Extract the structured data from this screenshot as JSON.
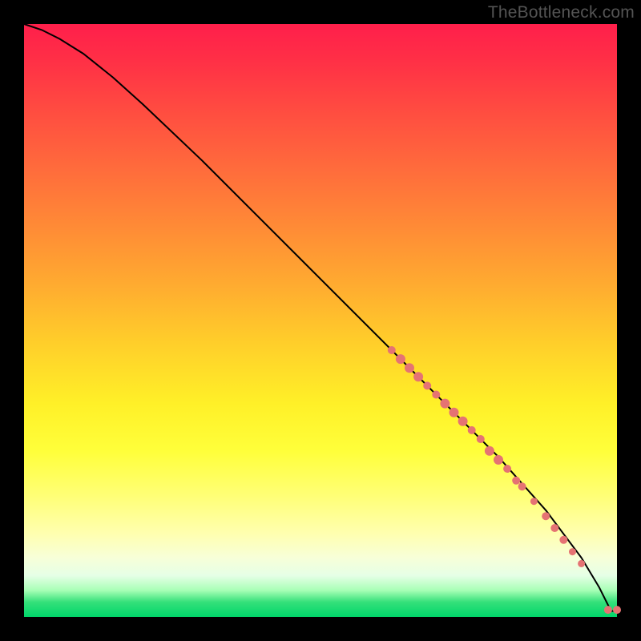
{
  "watermark": "TheBottleneck.com",
  "chart_data": {
    "type": "line",
    "title": "",
    "xlabel": "",
    "ylabel": "",
    "xlim": [
      0,
      100
    ],
    "ylim": [
      0,
      100
    ],
    "grid": false,
    "legend": false,
    "background": "rainbow-vertical-gradient",
    "series": [
      {
        "name": "curve",
        "kind": "line",
        "color": "#000000",
        "x": [
          0,
          3,
          6,
          10,
          15,
          20,
          30,
          40,
          50,
          60,
          70,
          80,
          88,
          94,
          97,
          99,
          100
        ],
        "y": [
          100,
          99,
          97.5,
          95,
          91,
          86.5,
          77,
          67,
          57,
          47,
          37,
          27,
          18,
          10,
          5,
          1,
          1
        ]
      },
      {
        "name": "highlight-points",
        "kind": "scatter",
        "color": "#e57373",
        "points": [
          {
            "x": 62,
            "y": 45,
            "r": 5
          },
          {
            "x": 63.5,
            "y": 43.5,
            "r": 6
          },
          {
            "x": 65,
            "y": 42,
            "r": 6
          },
          {
            "x": 66.5,
            "y": 40.5,
            "r": 6
          },
          {
            "x": 68,
            "y": 39,
            "r": 5
          },
          {
            "x": 69.5,
            "y": 37.5,
            "r": 5
          },
          {
            "x": 71,
            "y": 36,
            "r": 6
          },
          {
            "x": 72.5,
            "y": 34.5,
            "r": 6
          },
          {
            "x": 74,
            "y": 33,
            "r": 6
          },
          {
            "x": 75.5,
            "y": 31.5,
            "r": 5
          },
          {
            "x": 77,
            "y": 30,
            "r": 5
          },
          {
            "x": 78.5,
            "y": 28,
            "r": 6
          },
          {
            "x": 80,
            "y": 26.5,
            "r": 6
          },
          {
            "x": 81.5,
            "y": 25,
            "r": 5
          },
          {
            "x": 83,
            "y": 23,
            "r": 5
          },
          {
            "x": 84,
            "y": 22,
            "r": 5
          },
          {
            "x": 86,
            "y": 19.5,
            "r": 4.5
          },
          {
            "x": 88,
            "y": 17,
            "r": 5
          },
          {
            "x": 89.5,
            "y": 15,
            "r": 5
          },
          {
            "x": 91,
            "y": 13,
            "r": 5
          },
          {
            "x": 92.5,
            "y": 11,
            "r": 4.5
          },
          {
            "x": 94,
            "y": 9,
            "r": 4.5
          },
          {
            "x": 98.5,
            "y": 1.2,
            "r": 5
          },
          {
            "x": 100,
            "y": 1.2,
            "r": 5
          }
        ]
      }
    ]
  }
}
